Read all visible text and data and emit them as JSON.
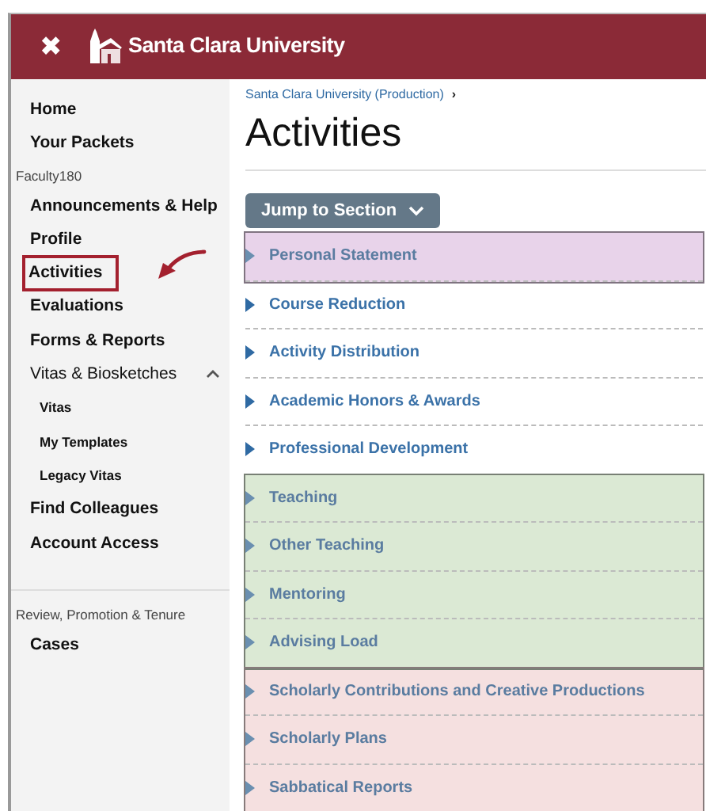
{
  "header": {
    "close": "✖",
    "brand": "Santa Clara University"
  },
  "sidebar": {
    "groups": [
      {
        "items": [
          {
            "label": "Home",
            "kind": "item",
            "highlighted": false
          },
          {
            "label": "Your Packets",
            "kind": "item",
            "highlighted": false
          }
        ]
      },
      {
        "heading": "Faculty180",
        "items": [
          {
            "label": "Announcements & Help",
            "kind": "item",
            "highlighted": false
          },
          {
            "label": "Profile",
            "kind": "item",
            "highlighted": false
          },
          {
            "label": "Activities",
            "kind": "item",
            "highlighted": true
          },
          {
            "label": "Evaluations",
            "kind": "item",
            "highlighted": false
          },
          {
            "label": "Forms & Reports",
            "kind": "item",
            "highlighted": false
          },
          {
            "label": "Vitas & Biosketches",
            "kind": "parent",
            "expanded": true,
            "highlighted": false,
            "children": [
              {
                "label": "Vitas",
                "kind": "subitem",
                "highlighted": false
              },
              {
                "label": "My Templates",
                "kind": "subitem",
                "highlighted": false
              },
              {
                "label": "Legacy Vitas",
                "kind": "subitem",
                "highlighted": false
              }
            ]
          },
          {
            "label": "Find Colleagues",
            "kind": "item",
            "highlighted": false
          },
          {
            "label": "Account Access",
            "kind": "item",
            "highlighted": false
          }
        ]
      },
      {
        "heading": "Review, Promotion & Tenure",
        "items": [
          {
            "label": "Cases",
            "kind": "item",
            "highlighted": false
          }
        ]
      }
    ]
  },
  "breadcrumb": {
    "link": "Santa Clara University (Production)",
    "separator": "›"
  },
  "title": "Activities",
  "jump_button": "Jump to Section",
  "section_groups": [
    {
      "color": "#e8d3ea",
      "sections": [
        "Personal Statement"
      ]
    },
    {
      "sections": [
        "Course Reduction",
        "Activity Distribution",
        "Academic Honors & Awards",
        "Professional Development"
      ]
    },
    {
      "color": "#dbe9d4",
      "sections": [
        "Teaching",
        "Other Teaching",
        "Mentoring",
        "Advising Load"
      ]
    },
    {
      "color": "#f5e0e0",
      "sections": [
        "Scholarly Contributions and Creative Productions",
        "Scholarly Plans",
        "Sabbatical Reports"
      ]
    }
  ]
}
